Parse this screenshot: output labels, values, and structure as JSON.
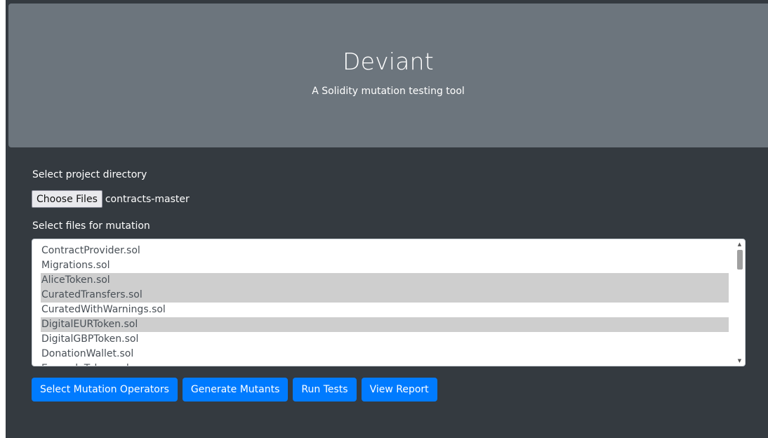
{
  "header": {
    "title": "Deviant",
    "subtitle": "A Solidity mutation testing tool"
  },
  "project": {
    "label": "Select project directory",
    "choose_button": "Choose Files",
    "chosen_value": "contracts-master"
  },
  "mutation_files": {
    "label": "Select files for mutation",
    "items": [
      {
        "label": "ContractProvider.sol",
        "selected": false
      },
      {
        "label": "Migrations.sol",
        "selected": false
      },
      {
        "label": "AliceToken.sol",
        "selected": true
      },
      {
        "label": "CuratedTransfers.sol",
        "selected": true
      },
      {
        "label": "CuratedWithWarnings.sol",
        "selected": false
      },
      {
        "label": "DigitalEURToken.sol",
        "selected": true
      },
      {
        "label": "DigitalGBPToken.sol",
        "selected": false
      },
      {
        "label": "DonationWallet.sol",
        "selected": false
      },
      {
        "label": "ExampleToken.sol",
        "selected": false
      }
    ]
  },
  "actions": {
    "select_operators": "Select Mutation Operators",
    "generate_mutants": "Generate Mutants",
    "run_tests": "Run Tests",
    "view_report": "View Report"
  },
  "colors": {
    "page_bg": "#343a40",
    "hero_bg": "#6c757d",
    "primary": "#007bff",
    "selected_item": "#cecece"
  }
}
